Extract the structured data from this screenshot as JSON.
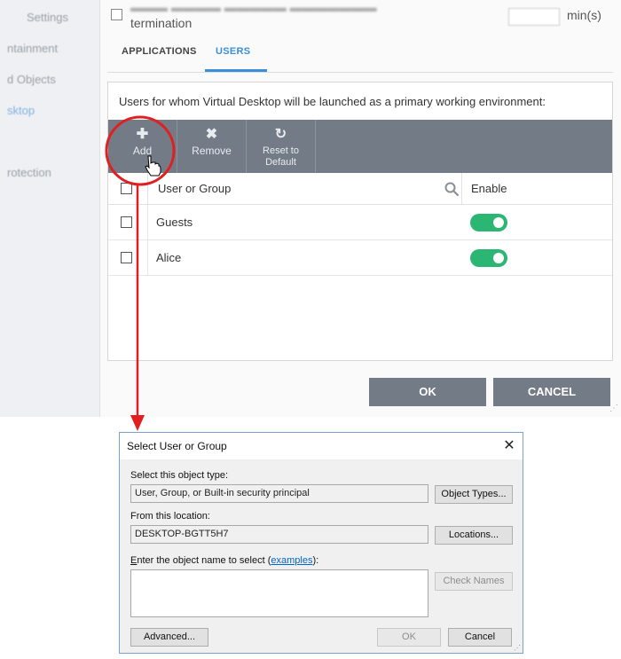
{
  "background": {
    "sidebar_items": [
      "Settings",
      "ntainment",
      "d Objects",
      "sktop",
      "rotection"
    ],
    "top_option_text": "termination",
    "minutes_label": "min(s)",
    "tabs": [
      "APPLICATIONS",
      "USERS"
    ],
    "description": "Users for whom Virtual Desktop will be launched as a primary working environment:",
    "toolbar": {
      "add_label": "Add",
      "remove_label": "Remove",
      "reset_line1": "Reset to",
      "reset_line2": "Default"
    },
    "table": {
      "col_user": "User or Group",
      "col_enable": "Enable",
      "rows": [
        {
          "name": "Guests",
          "enabled": true
        },
        {
          "name": "Alice",
          "enabled": true
        }
      ]
    },
    "ok_label": "OK",
    "cancel_label": "CANCEL"
  },
  "dialog": {
    "title": "Select User or Group",
    "object_type_label": "Select this object type:",
    "object_type_value": "User, Group, or Built-in security principal",
    "object_types_button": "Object Types...",
    "location_label": "From this location:",
    "location_value": "DESKTOP-BGTT5H7",
    "locations_button": "Locations...",
    "enter_name_label_pre": "nter the object name to select (",
    "enter_name_label_accel": "E",
    "examples_link": "examples",
    "enter_name_label_post": "):",
    "check_names_button": "Check Names",
    "advanced_button": "Advanced...",
    "ok_button": "OK",
    "cancel_button": "Cancel"
  },
  "colors": {
    "toolbar": "#737b87",
    "accent": "#3a8fd8",
    "toggle_on": "#2bb673",
    "callout": "#e02020"
  }
}
